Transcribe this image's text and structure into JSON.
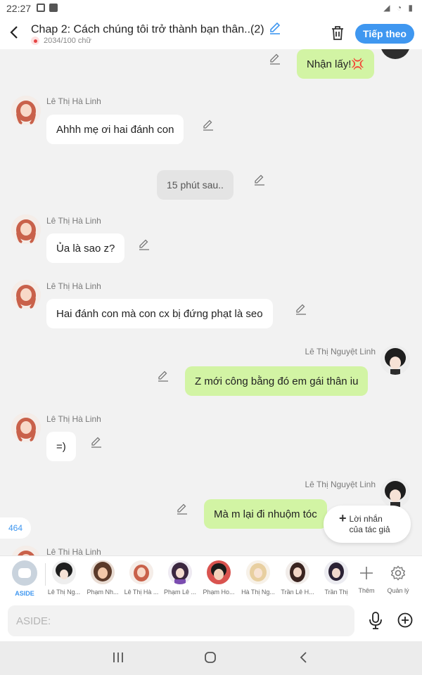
{
  "status_bar": {
    "time": "22:27"
  },
  "header": {
    "title": "Chap 2: Cách chúng tôi trở thành bạn thân..(2)",
    "word_count": "2034/100 chữ",
    "follow_label": "Tiếp theo"
  },
  "messages": [
    {
      "text": "Nhận lấy!💢"
    },
    {
      "name": "Lê Thị Hà Linh",
      "text": "Ahhh mẹ ơi hai đánh con"
    },
    {
      "text": "15 phút sau.."
    },
    {
      "name": "Lê Thị Hà Linh",
      "text": "Ủa là sao z?"
    },
    {
      "name": "Lê Thị Hà Linh",
      "text": "Hai đánh con mà con cx bị đứng phạt là seo"
    },
    {
      "name": "Lê Thị Nguyệt Linh",
      "text": "Z mới công bằng đó em gái thân iu"
    },
    {
      "name": "Lê Thị Hà Linh",
      "text": "=)"
    },
    {
      "name": "Lê Thị Nguyệt Linh",
      "text": "Mà m lại đi nhuộm tóc"
    },
    {
      "name": "Lê Thị Hà Linh"
    }
  ],
  "unread_count": "464",
  "author_note_label": "Lời nhắn của tác giả",
  "characters": [
    {
      "label": "ASIDE"
    },
    {
      "label": "Lê Thị Ng..."
    },
    {
      "label": "Phạm Nh..."
    },
    {
      "label": "Lê Thị Hà ..."
    },
    {
      "label": "Phạm Lê ..."
    },
    {
      "label": "Phạm Ho..."
    },
    {
      "label": "Hà Thị Ng..."
    },
    {
      "label": "Trần Lê H..."
    },
    {
      "label": "Trần Thị"
    },
    {
      "label": "Thêm"
    },
    {
      "label": "Quản lý"
    }
  ],
  "input": {
    "placeholder": "ASIDE:"
  },
  "colors": {
    "accent": "#3f97f0",
    "own_bubble": "#d2f4a4",
    "other_bubble": "#ffffff"
  },
  "icons": [
    "back-icon",
    "edit-icon",
    "trash-icon",
    "pencil-icon",
    "microphone-icon",
    "add-circle-icon",
    "plus-icon",
    "gear-icon",
    "recent-apps-icon",
    "home-icon",
    "nav-back-icon"
  ]
}
